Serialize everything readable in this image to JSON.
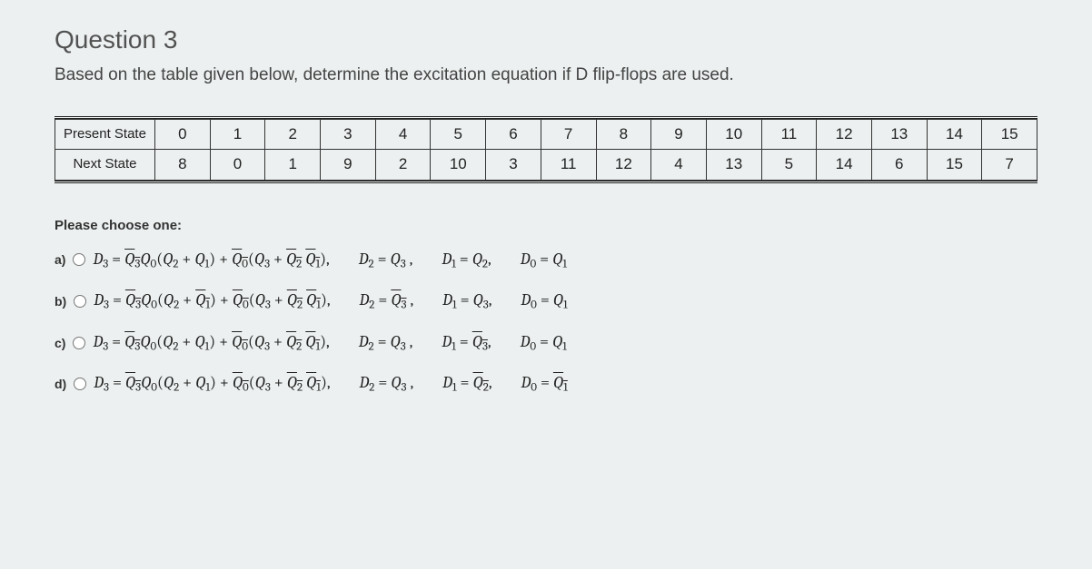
{
  "title": "Question 3",
  "prompt": "Based on the table given below, determine the excitation equation if D flip-flops are used.",
  "table": {
    "row1_label": "Present State",
    "row2_label": "Next State",
    "present": [
      "0",
      "1",
      "2",
      "3",
      "4",
      "5",
      "6",
      "7",
      "8",
      "9",
      "10",
      "11",
      "12",
      "13",
      "14",
      "15"
    ],
    "next": [
      "8",
      "0",
      "1",
      "9",
      "2",
      "10",
      "3",
      "11",
      "12",
      "4",
      "13",
      "5",
      "14",
      "6",
      "15",
      "7"
    ]
  },
  "choose_label": "Please choose one:",
  "options": {
    "a": "a)",
    "b": "b)",
    "c": "c)",
    "d": "d)"
  }
}
